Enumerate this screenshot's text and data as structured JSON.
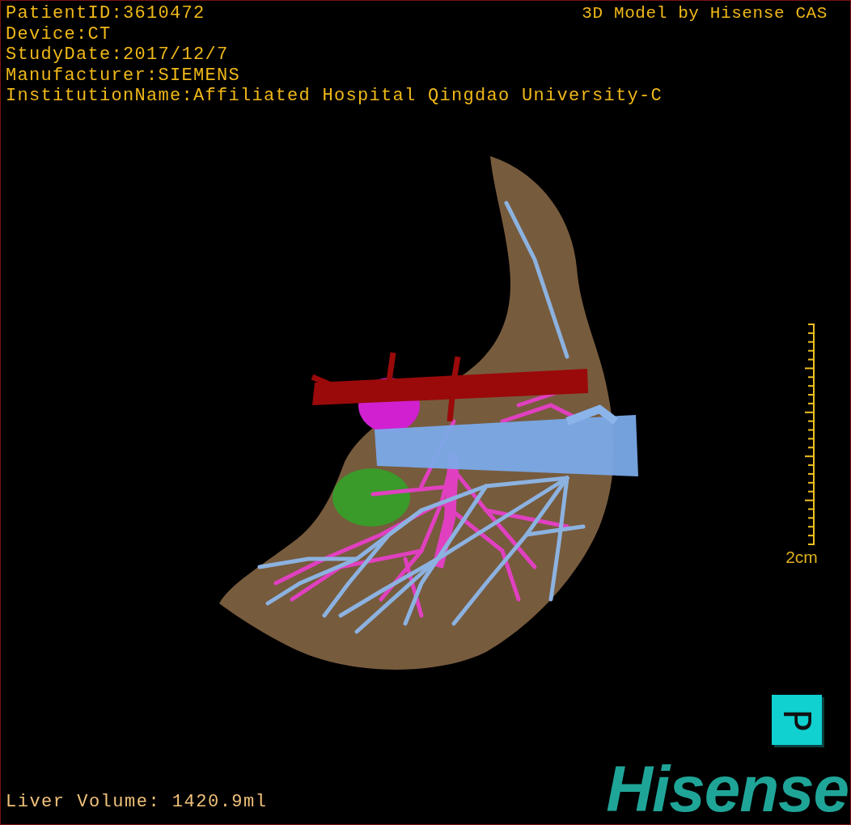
{
  "header_info": [
    "PatientID:3610472",
    "Device:CT",
    "StudyDate:2017/12/7",
    "Manufacturer:SIEMENS",
    "InstitutionName:Affiliated Hospital Qingdao University-C"
  ],
  "credit": "3D Model by Hisense CAS",
  "scale_bar": {
    "label": "2cm"
  },
  "orientation_marker": {
    "label": "P"
  },
  "footer": {
    "liver_volume": "Liver Volume: 1420.9ml"
  },
  "logo": {
    "text": "Hisense"
  }
}
